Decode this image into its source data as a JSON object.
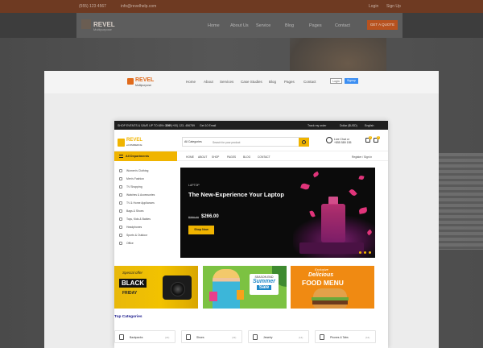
{
  "background": {
    "topbar": {
      "phone": "(555) 123 4567",
      "email": "info@revelhelp.com",
      "login": "Login",
      "signup": "Sign Up"
    },
    "logo": {
      "title": "REVEL",
      "subtitle": "Multipurpose"
    },
    "nav": [
      "Home",
      "About Us",
      "Service",
      "Blog",
      "Pages",
      "Contact"
    ],
    "cta": "GET A QUOTE"
  },
  "middle": {
    "logo": {
      "title": "REVEL",
      "subtitle": "Multipurpose"
    },
    "nav": [
      "Home",
      "About",
      "Services",
      "Case Studies",
      "Blog",
      "Pages",
      "Contact"
    ],
    "login": "Login",
    "signup": "Signup"
  },
  "store": {
    "topbar": {
      "promo": "SHOP EVENTS & SAVE UP TO 65% OFF!",
      "call": "Call (+00) 123- 456789",
      "email": "Get 10 Email",
      "track": "Track my order",
      "currency": "Dollar ($USD)",
      "language": "English"
    },
    "logo": {
      "title": "REVEL",
      "subtitle": "eCOMMERCE"
    },
    "search": {
      "category": "All Categories",
      "placeholder": "Search for your product"
    },
    "support": {
      "label": "Live Chat or",
      "phone": "+855 589 155"
    },
    "cart_count": "0",
    "wishlist_count": "0",
    "all_departments": "All Departments",
    "nav": [
      "HOME",
      "ABOUT",
      "SHOP",
      "PAGES",
      "BLOG",
      "CONTACT"
    ],
    "account": "Register / Sign in",
    "sidebar": [
      "Women's Clothing",
      "Men's Fashion",
      "TV Shopping",
      "Watches & Accessories",
      "TV & Home Appliances",
      "Bags & Shoes",
      "Toys, Kids & Babies",
      "Headphones",
      "Sports & Outdoor",
      "Office"
    ],
    "hero": {
      "tag": "LAPTOP",
      "title": "The New-Experience Your Laptop",
      "old_price": "$350.00",
      "new_price": "$266.00",
      "button": "Shop Now"
    },
    "banners": {
      "b1": {
        "tag": "Special offer",
        "black": "BLACK",
        "friday": "FRIDAY"
      },
      "b2": {
        "tag": "SEASON END",
        "title": "Summer",
        "sale": "Sale"
      },
      "b3": {
        "tag": "Exclusive",
        "title1": "Delicious",
        "title2": "FOOD MENU"
      }
    },
    "top_categories_title": "Top Categories",
    "categories": [
      {
        "name": "Backpacks",
        "count": "(23)"
      },
      {
        "name": "Shoes",
        "count": "(43)"
      },
      {
        "name": "Jewelry",
        "count": "(14)"
      },
      {
        "name": "Phones & Tabs",
        "count": "(16)"
      }
    ]
  }
}
